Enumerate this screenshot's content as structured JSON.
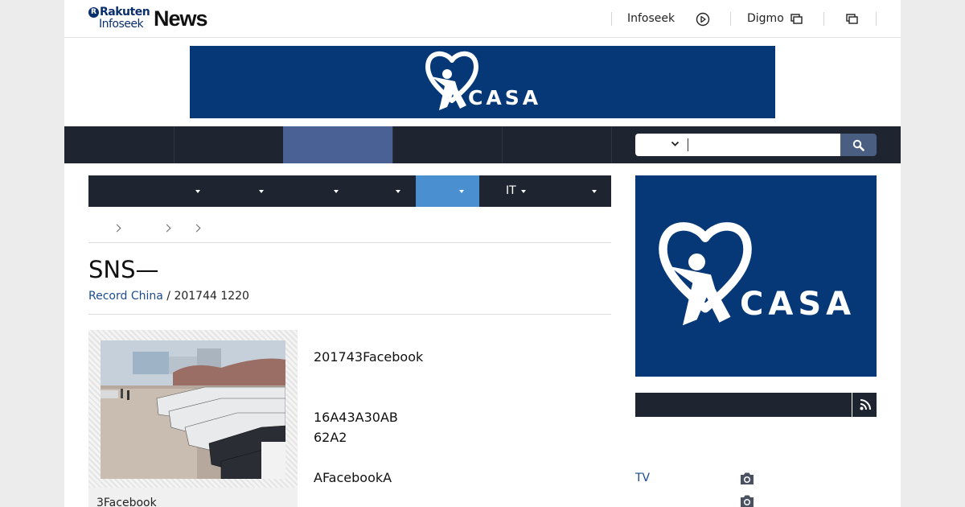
{
  "header": {
    "logo": {
      "rakuten": "Rakuten",
      "infoseek": "Infoseek",
      "news": "News"
    },
    "links": [
      {
        "label": "Infoseek",
        "icon": "play-circle-icon"
      },
      {
        "label": "Digmo",
        "icon": "external-window-icon"
      }
    ],
    "extra_icon": "external-window-icon"
  },
  "banner": {
    "brand": "CASA",
    "icon": "heart-person-logo"
  },
  "darknav": {
    "items": [
      "",
      "",
      "",
      "",
      ""
    ],
    "active_index": 2,
    "search": {
      "placeholder": "",
      "dropdown_icon": "chevron-down-icon",
      "button_icon": "search-icon"
    }
  },
  "subnav": {
    "items": [
      {
        "label": "",
        "has_dropdown": true
      },
      {
        "label": "",
        "has_dropdown": true
      },
      {
        "label": "",
        "has_dropdown": true
      },
      {
        "label": "",
        "has_dropdown": true
      },
      {
        "label": "",
        "has_dropdown": true,
        "active": true
      },
      {
        "label": "IT",
        "has_dropdown": true
      },
      {
        "label": "",
        "has_dropdown": true
      }
    ]
  },
  "breadcrumb": {
    "items": [
      "",
      "",
      "",
      ""
    ]
  },
  "article": {
    "title": "SNS—",
    "source": "Record China",
    "date": "201744 1220",
    "caption": "3Facebook",
    "paragraphs": [
      "201743Facebook",
      "16A43A30AB",
      "62A2",
      "AFacebookA"
    ]
  },
  "sidebar": {
    "ad_brand": "CASA",
    "rss_icon": "rss-icon",
    "link": "TV",
    "photo_icons": [
      "camera-icon",
      "camera-icon"
    ]
  },
  "colors": {
    "navy": "#063878",
    "dark": "#1e2530",
    "active_nav": "#4a6196",
    "active_sub": "#4a90d0",
    "link": "#1a4c8c"
  }
}
